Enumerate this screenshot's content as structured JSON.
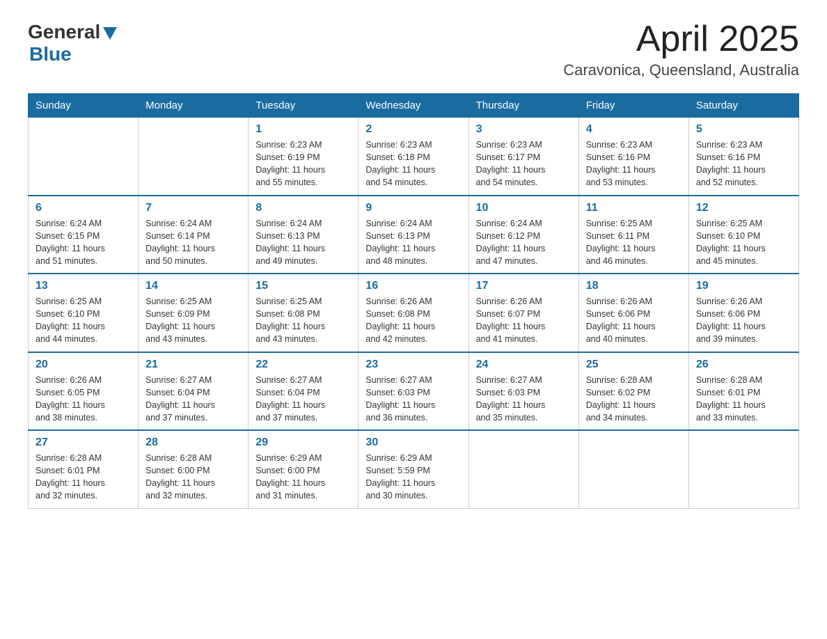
{
  "logo": {
    "general": "General",
    "blue": "Blue"
  },
  "title": "April 2025",
  "location": "Caravonica, Queensland, Australia",
  "days_of_week": [
    "Sunday",
    "Monday",
    "Tuesday",
    "Wednesday",
    "Thursday",
    "Friday",
    "Saturday"
  ],
  "weeks": [
    [
      {
        "day": "",
        "info": ""
      },
      {
        "day": "",
        "info": ""
      },
      {
        "day": "1",
        "info": "Sunrise: 6:23 AM\nSunset: 6:19 PM\nDaylight: 11 hours\nand 55 minutes."
      },
      {
        "day": "2",
        "info": "Sunrise: 6:23 AM\nSunset: 6:18 PM\nDaylight: 11 hours\nand 54 minutes."
      },
      {
        "day": "3",
        "info": "Sunrise: 6:23 AM\nSunset: 6:17 PM\nDaylight: 11 hours\nand 54 minutes."
      },
      {
        "day": "4",
        "info": "Sunrise: 6:23 AM\nSunset: 6:16 PM\nDaylight: 11 hours\nand 53 minutes."
      },
      {
        "day": "5",
        "info": "Sunrise: 6:23 AM\nSunset: 6:16 PM\nDaylight: 11 hours\nand 52 minutes."
      }
    ],
    [
      {
        "day": "6",
        "info": "Sunrise: 6:24 AM\nSunset: 6:15 PM\nDaylight: 11 hours\nand 51 minutes."
      },
      {
        "day": "7",
        "info": "Sunrise: 6:24 AM\nSunset: 6:14 PM\nDaylight: 11 hours\nand 50 minutes."
      },
      {
        "day": "8",
        "info": "Sunrise: 6:24 AM\nSunset: 6:13 PM\nDaylight: 11 hours\nand 49 minutes."
      },
      {
        "day": "9",
        "info": "Sunrise: 6:24 AM\nSunset: 6:13 PM\nDaylight: 11 hours\nand 48 minutes."
      },
      {
        "day": "10",
        "info": "Sunrise: 6:24 AM\nSunset: 6:12 PM\nDaylight: 11 hours\nand 47 minutes."
      },
      {
        "day": "11",
        "info": "Sunrise: 6:25 AM\nSunset: 6:11 PM\nDaylight: 11 hours\nand 46 minutes."
      },
      {
        "day": "12",
        "info": "Sunrise: 6:25 AM\nSunset: 6:10 PM\nDaylight: 11 hours\nand 45 minutes."
      }
    ],
    [
      {
        "day": "13",
        "info": "Sunrise: 6:25 AM\nSunset: 6:10 PM\nDaylight: 11 hours\nand 44 minutes."
      },
      {
        "day": "14",
        "info": "Sunrise: 6:25 AM\nSunset: 6:09 PM\nDaylight: 11 hours\nand 43 minutes."
      },
      {
        "day": "15",
        "info": "Sunrise: 6:25 AM\nSunset: 6:08 PM\nDaylight: 11 hours\nand 43 minutes."
      },
      {
        "day": "16",
        "info": "Sunrise: 6:26 AM\nSunset: 6:08 PM\nDaylight: 11 hours\nand 42 minutes."
      },
      {
        "day": "17",
        "info": "Sunrise: 6:26 AM\nSunset: 6:07 PM\nDaylight: 11 hours\nand 41 minutes."
      },
      {
        "day": "18",
        "info": "Sunrise: 6:26 AM\nSunset: 6:06 PM\nDaylight: 11 hours\nand 40 minutes."
      },
      {
        "day": "19",
        "info": "Sunrise: 6:26 AM\nSunset: 6:06 PM\nDaylight: 11 hours\nand 39 minutes."
      }
    ],
    [
      {
        "day": "20",
        "info": "Sunrise: 6:26 AM\nSunset: 6:05 PM\nDaylight: 11 hours\nand 38 minutes."
      },
      {
        "day": "21",
        "info": "Sunrise: 6:27 AM\nSunset: 6:04 PM\nDaylight: 11 hours\nand 37 minutes."
      },
      {
        "day": "22",
        "info": "Sunrise: 6:27 AM\nSunset: 6:04 PM\nDaylight: 11 hours\nand 37 minutes."
      },
      {
        "day": "23",
        "info": "Sunrise: 6:27 AM\nSunset: 6:03 PM\nDaylight: 11 hours\nand 36 minutes."
      },
      {
        "day": "24",
        "info": "Sunrise: 6:27 AM\nSunset: 6:03 PM\nDaylight: 11 hours\nand 35 minutes."
      },
      {
        "day": "25",
        "info": "Sunrise: 6:28 AM\nSunset: 6:02 PM\nDaylight: 11 hours\nand 34 minutes."
      },
      {
        "day": "26",
        "info": "Sunrise: 6:28 AM\nSunset: 6:01 PM\nDaylight: 11 hours\nand 33 minutes."
      }
    ],
    [
      {
        "day": "27",
        "info": "Sunrise: 6:28 AM\nSunset: 6:01 PM\nDaylight: 11 hours\nand 32 minutes."
      },
      {
        "day": "28",
        "info": "Sunrise: 6:28 AM\nSunset: 6:00 PM\nDaylight: 11 hours\nand 32 minutes."
      },
      {
        "day": "29",
        "info": "Sunrise: 6:29 AM\nSunset: 6:00 PM\nDaylight: 11 hours\nand 31 minutes."
      },
      {
        "day": "30",
        "info": "Sunrise: 6:29 AM\nSunset: 5:59 PM\nDaylight: 11 hours\nand 30 minutes."
      },
      {
        "day": "",
        "info": ""
      },
      {
        "day": "",
        "info": ""
      },
      {
        "day": "",
        "info": ""
      }
    ]
  ]
}
